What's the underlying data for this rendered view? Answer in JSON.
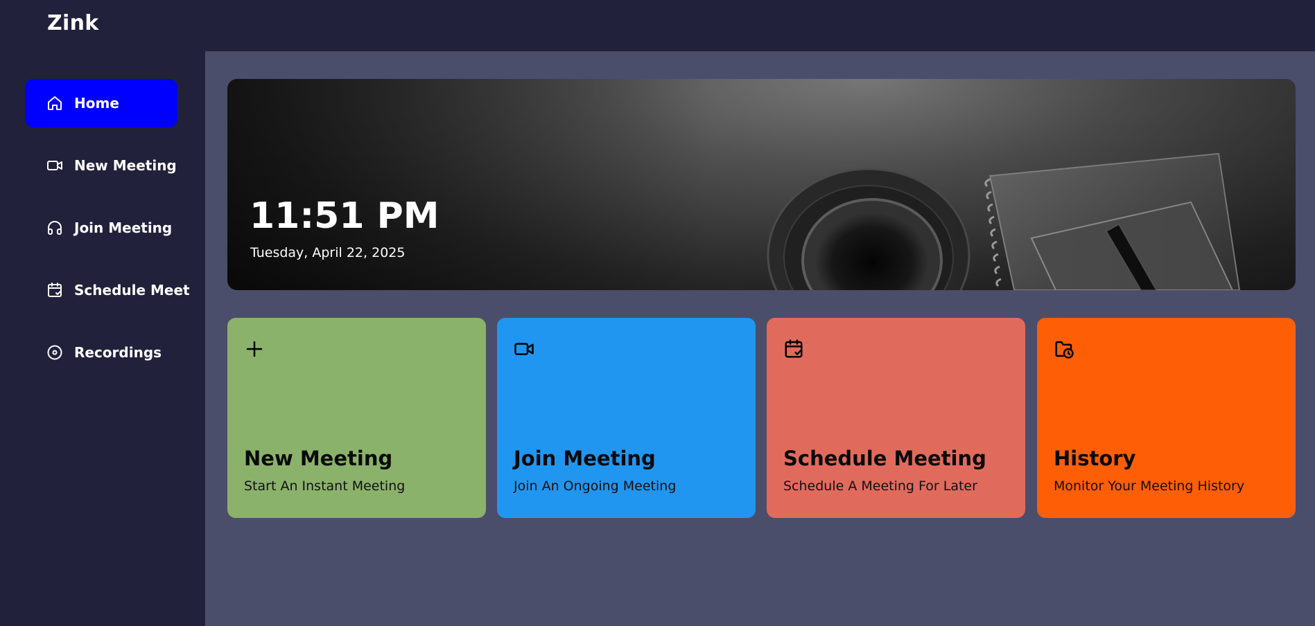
{
  "app": {
    "title": "Zink"
  },
  "sidebar": {
    "items": [
      {
        "label": "Home",
        "icon": "home-icon",
        "active": true
      },
      {
        "label": "New Meeting",
        "icon": "video-icon",
        "active": false
      },
      {
        "label": "Join Meeting",
        "icon": "headset-icon",
        "active": false
      },
      {
        "label": "Schedule Meet",
        "icon": "calendar-check-icon",
        "active": false
      },
      {
        "label": "Recordings",
        "icon": "disc-icon",
        "active": false
      }
    ]
  },
  "hero": {
    "time": "11:51 PM",
    "date": "Tuesday, April 22, 2025"
  },
  "cards": [
    {
      "title": "New Meeting",
      "subtitle": "Start An Instant Meeting",
      "icon": "plus-icon",
      "color": "#8bb26b"
    },
    {
      "title": "Join Meeting",
      "subtitle": "Join An Ongoing Meeting",
      "icon": "video-icon",
      "color": "#2196f0"
    },
    {
      "title": "Schedule Meeting",
      "subtitle": "Schedule A Meeting For Later",
      "icon": "calendar-check-icon",
      "color": "#e06b5d"
    },
    {
      "title": "History",
      "subtitle": "Monitor Your Meeting History",
      "icon": "folder-clock-icon",
      "color": "#fe5e06"
    }
  ],
  "colors": {
    "sidebar_bg": "#21213b",
    "main_bg": "#4a4e6a",
    "active_nav": "#0000ff"
  }
}
